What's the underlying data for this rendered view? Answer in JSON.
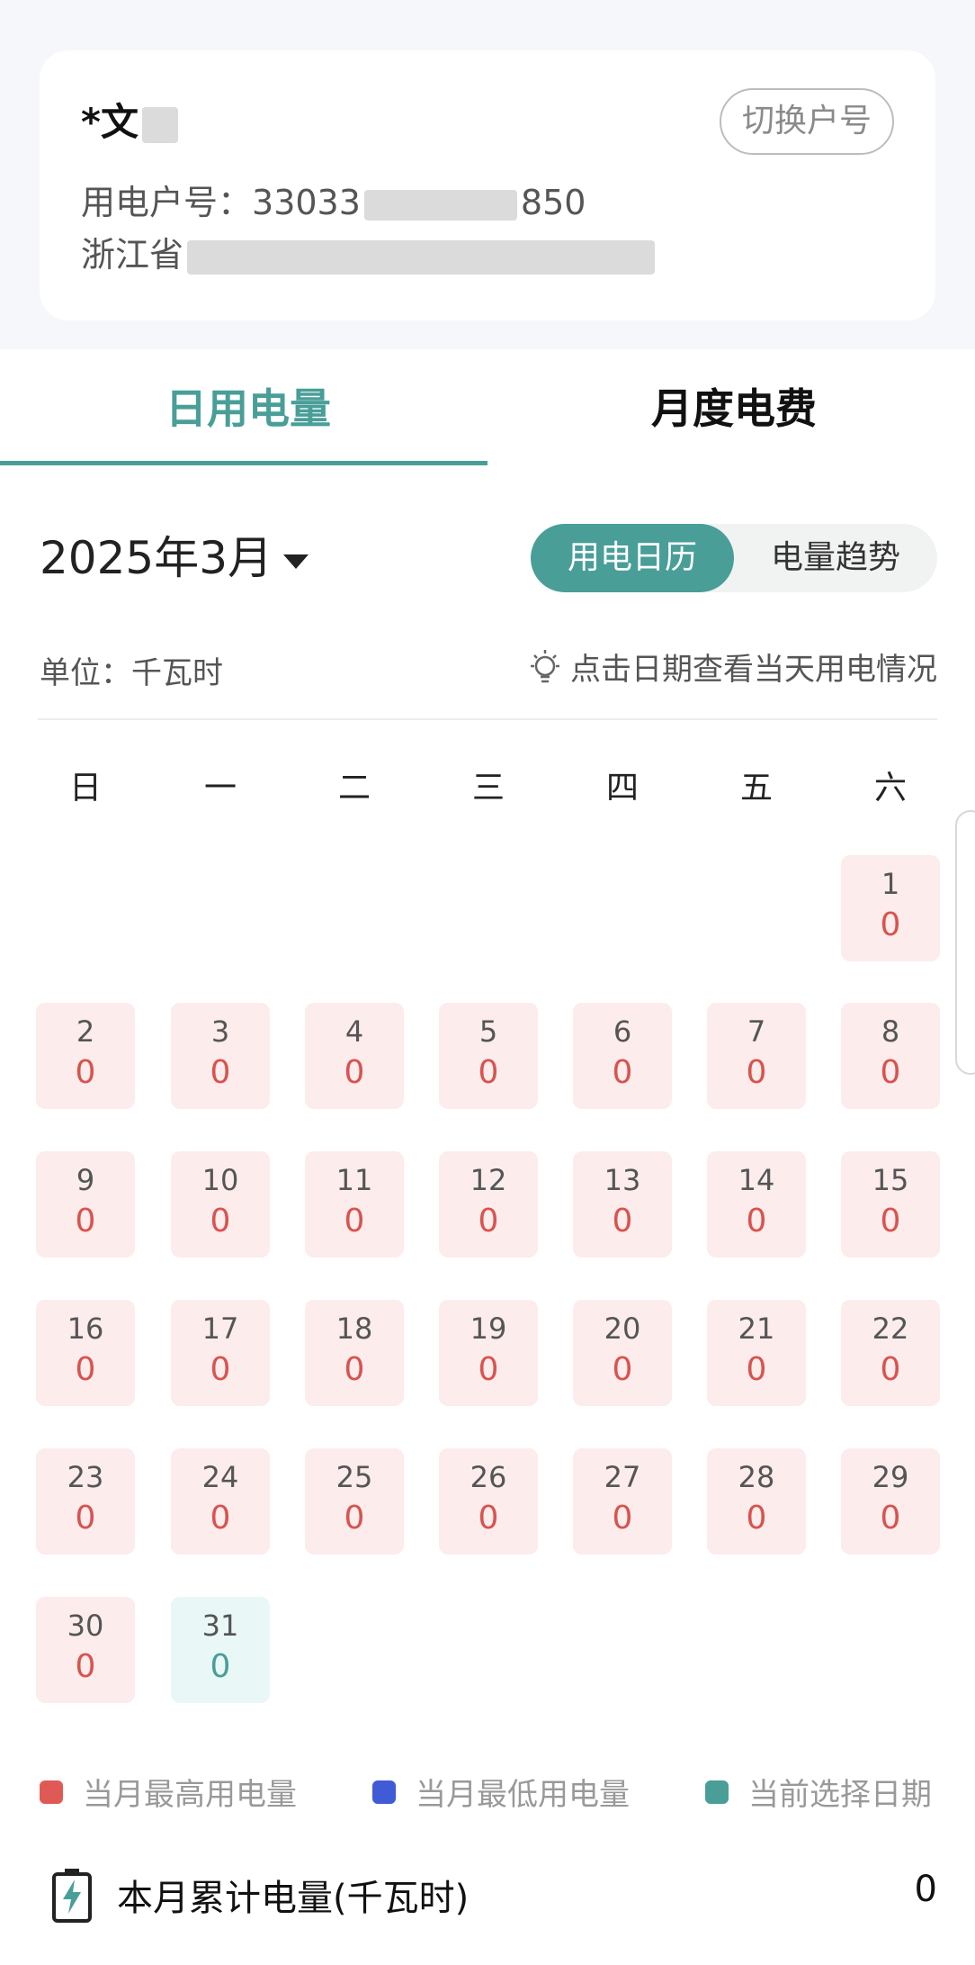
{
  "account": {
    "name": "*文",
    "switch_label": "切换户号",
    "number_label": "用电户号：",
    "number_visible_prefix": "33033",
    "number_visible_suffix": "850",
    "address_prefix": "浙江省"
  },
  "tabs": {
    "daily": "日用电量",
    "monthly": "月度电费"
  },
  "month": {
    "label": "2025年3月"
  },
  "toggle": {
    "calendar": "用电日历",
    "trend": "电量趋势"
  },
  "unit": "单位：千瓦时",
  "hint": "点击日期查看当天用电情况",
  "weekdays": [
    "日",
    "一",
    "二",
    "三",
    "四",
    "五",
    "六"
  ],
  "days": [
    {
      "day": "1",
      "value": "0"
    },
    {
      "day": "2",
      "value": "0"
    },
    {
      "day": "3",
      "value": "0"
    },
    {
      "day": "4",
      "value": "0"
    },
    {
      "day": "5",
      "value": "0"
    },
    {
      "day": "6",
      "value": "0"
    },
    {
      "day": "7",
      "value": "0"
    },
    {
      "day": "8",
      "value": "0"
    },
    {
      "day": "9",
      "value": "0"
    },
    {
      "day": "10",
      "value": "0"
    },
    {
      "day": "11",
      "value": "0"
    },
    {
      "day": "12",
      "value": "0"
    },
    {
      "day": "13",
      "value": "0"
    },
    {
      "day": "14",
      "value": "0"
    },
    {
      "day": "15",
      "value": "0"
    },
    {
      "day": "16",
      "value": "0"
    },
    {
      "day": "17",
      "value": "0"
    },
    {
      "day": "18",
      "value": "0"
    },
    {
      "day": "19",
      "value": "0"
    },
    {
      "day": "20",
      "value": "0"
    },
    {
      "day": "21",
      "value": "0"
    },
    {
      "day": "22",
      "value": "0"
    },
    {
      "day": "23",
      "value": "0"
    },
    {
      "day": "24",
      "value": "0"
    },
    {
      "day": "25",
      "value": "0"
    },
    {
      "day": "26",
      "value": "0"
    },
    {
      "day": "27",
      "value": "0"
    },
    {
      "day": "28",
      "value": "0"
    },
    {
      "day": "29",
      "value": "0"
    },
    {
      "day": "30",
      "value": "0"
    },
    {
      "day": "31",
      "value": "0",
      "selected": true
    }
  ],
  "legend": {
    "max_label": "当月最高用电量",
    "max_color": "#e05a55",
    "min_label": "当月最低用电量",
    "min_color": "#3f5bd6",
    "selected_label": "当前选择日期",
    "selected_color": "#4a9e98"
  },
  "total": {
    "label": "本月累计电量(千瓦时)",
    "value": "0"
  }
}
